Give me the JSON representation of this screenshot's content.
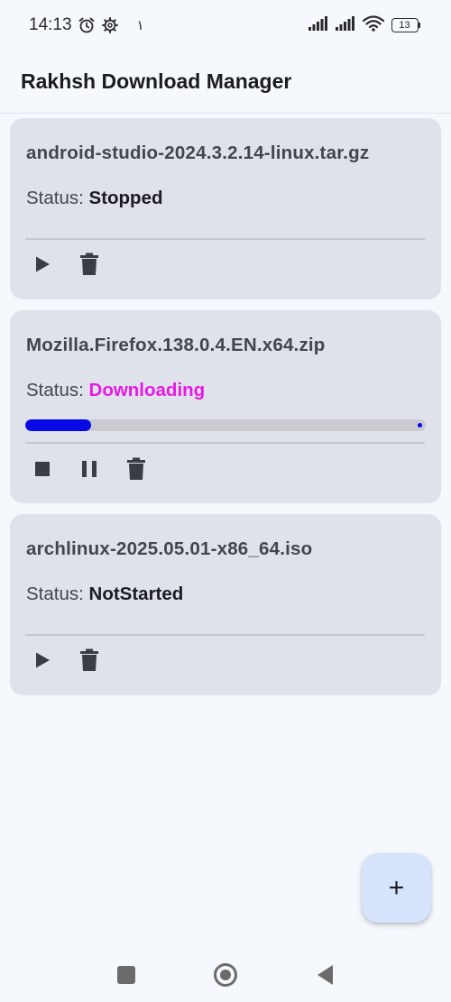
{
  "status_bar": {
    "time": "14:13",
    "extra": "١",
    "battery": "13",
    "icons": [
      "alarm-icon",
      "gear-icon",
      "signal-icon",
      "signal-icon",
      "wifi-icon",
      "battery-icon"
    ]
  },
  "app_bar": {
    "title": "Rakhsh Download Manager"
  },
  "status_label": "Status:",
  "downloads": [
    {
      "file_name": "android-studio-2024.3.2.14-linux.tar.gz",
      "status": "Stopped",
      "actions": [
        "play-icon",
        "delete-icon"
      ]
    },
    {
      "file_name": "Mozilla.Firefox.138.0.4.EN.x64.zip",
      "status": "Downloading",
      "status_color": "#e619e6",
      "progress": 0.165,
      "actions": [
        "stop-icon",
        "pause-icon",
        "delete-icon"
      ]
    },
    {
      "file_name": "archlinux-2025.05.01-x86_64.iso",
      "status": "NotStarted",
      "actions": [
        "play-icon",
        "delete-icon"
      ]
    }
  ],
  "fab": {
    "icon": "add-icon",
    "symbol": "+"
  },
  "nav": {
    "icons": [
      "recents-icon",
      "home-icon",
      "back-icon"
    ]
  },
  "colors": {
    "background": "#f5f9fe",
    "card": "#dfe2eb",
    "progress": "#0909e6",
    "fab": "#d6e3fb"
  }
}
